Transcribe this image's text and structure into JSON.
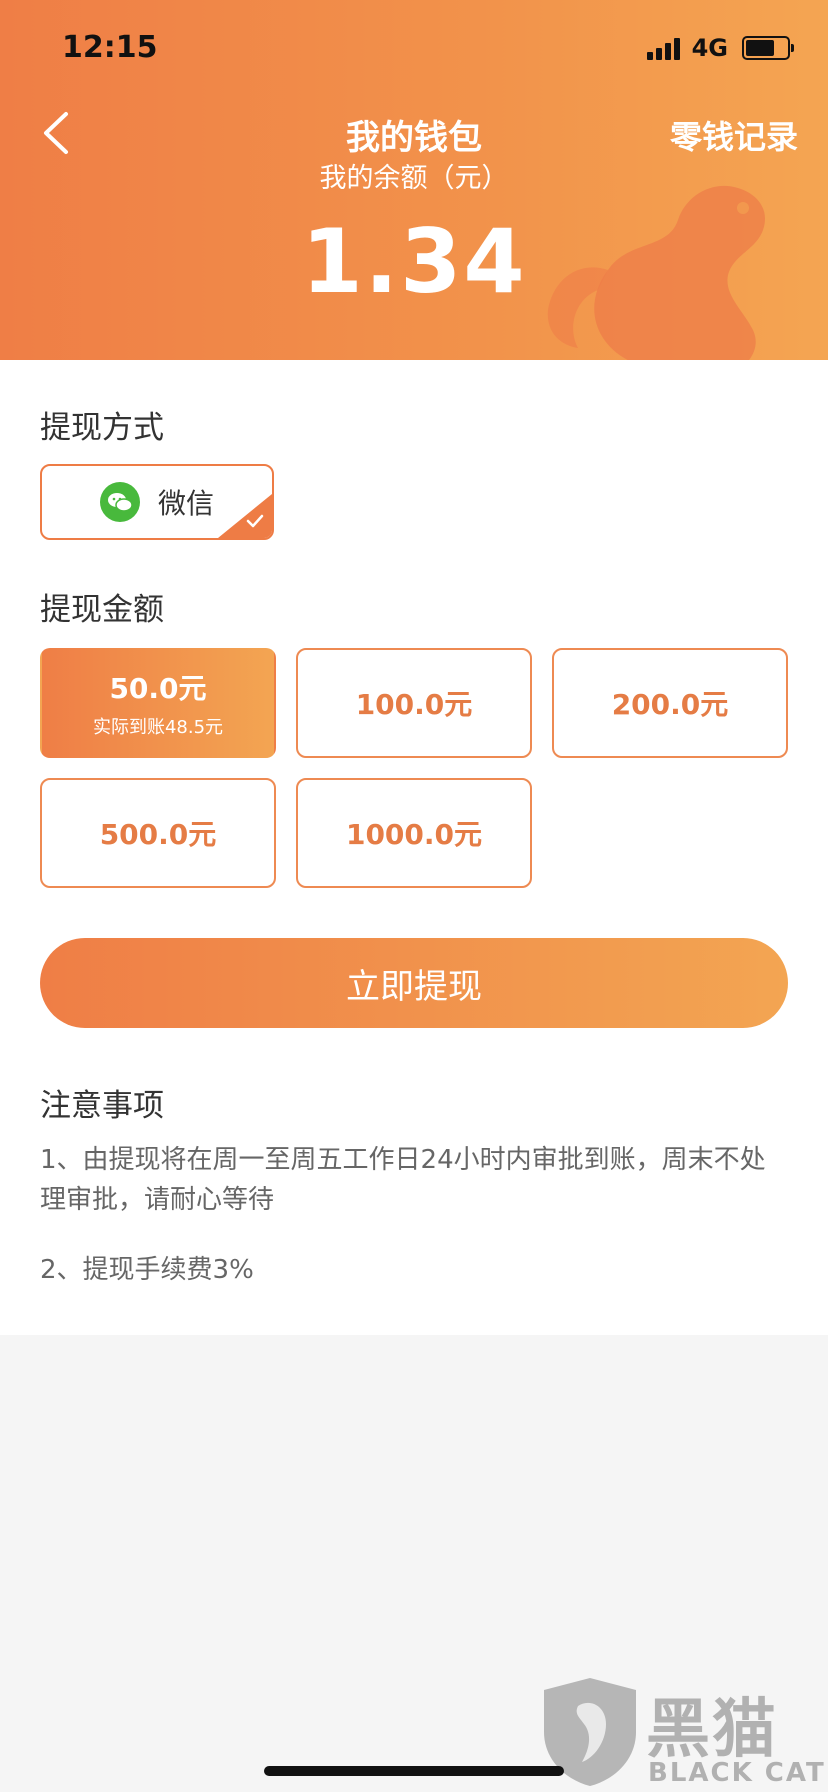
{
  "status_bar": {
    "time": "12:15",
    "network": "4G",
    "battery_level": 0.75
  },
  "header": {
    "title": "我的钱包",
    "record_link": "零钱记录",
    "balance_label": "我的余额（元）",
    "balance": "1.34",
    "back_icon": "chevron-left-icon"
  },
  "withdraw_method": {
    "title": "提现方式",
    "option": {
      "label": "微信",
      "icon": "wechat-icon",
      "selected": true
    }
  },
  "withdraw_amount": {
    "title": "提现金额",
    "options": [
      {
        "value": "50.0元",
        "sub": "实际到账48.5元",
        "selected": true
      },
      {
        "value": "100.0元"
      },
      {
        "value": "200.0元"
      },
      {
        "value": "500.0元"
      },
      {
        "value": "1000.0元"
      }
    ]
  },
  "submit_label": "立即提现",
  "notes": {
    "title": "注意事项",
    "items": [
      "1、由提现将在周一至周五工作日24小时内审批到账，周末不处理审批，请耐心等待",
      "2、提现手续费3%"
    ]
  },
  "watermark": {
    "main": "黑猫",
    "sub": "BLACK CAT"
  },
  "colors": {
    "accent_start": "#ef7e46",
    "accent_end": "#f4a552",
    "wechat": "#48b93c"
  }
}
